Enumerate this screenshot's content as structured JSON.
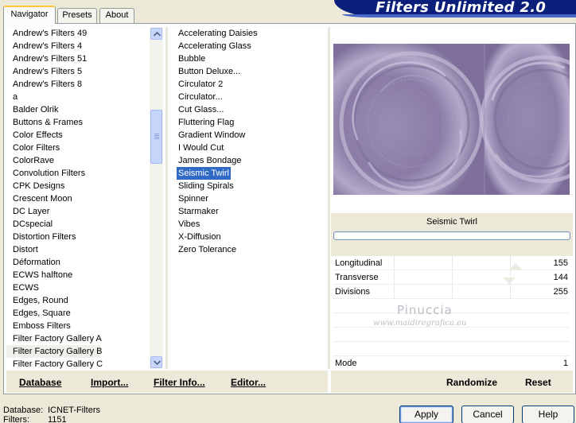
{
  "header": {
    "title": "Filters Unlimited 2.0"
  },
  "tabs": [
    {
      "label": "Navigator",
      "active": true
    },
    {
      "label": "Presets",
      "active": false
    },
    {
      "label": "About",
      "active": false
    }
  ],
  "categories": [
    "Andrew's Filters 49",
    "Andrew's Filters 4",
    "Andrew's Filters 51",
    "Andrew's Filters 5",
    "Andrew's Filters 8",
    "a",
    "Balder Olrik",
    "Buttons & Frames",
    "Color Effects",
    "Color Filters",
    "ColorRave",
    "Convolution Filters",
    "CPK Designs",
    "Crescent Moon",
    "DC Layer",
    "DCspecial",
    "Distortion Filters",
    "Distort",
    "Déformation",
    "ECWS halftone",
    "ECWS",
    "Edges, Round",
    "Edges, Square",
    "Emboss Filters",
    "Filter Factory Gallery A",
    "Filter Factory Gallery B",
    "Filter Factory Gallery C"
  ],
  "current_category": "Filter Factory Gallery B",
  "filters": [
    "Accelerating Daisies",
    "Accelerating Glass",
    "Bubble",
    "Button Deluxe...",
    "Circulator 2",
    "Circulator...",
    "Cut Glass...",
    "Fluttering Flag",
    "Gradient Window",
    "I Would Cut",
    "James Bondage",
    "Seismic Twirl",
    "Sliding Spirals",
    "Spinner",
    "Starmaker",
    "Vibes",
    "X-Diffusion",
    "Zero Tolerance"
  ],
  "selected_filter": "Seismic Twirl",
  "preview": {
    "filter_name": "Seismic Twirl",
    "tint": "#8e80a9"
  },
  "params": [
    {
      "label": "Longitudinal",
      "value": "155",
      "level": 155
    },
    {
      "label": "Transverse",
      "value": "144",
      "level": 144
    },
    {
      "label": "Divisions",
      "value": "255",
      "level": 255
    }
  ],
  "mode": {
    "label": "Mode",
    "value": "1"
  },
  "watermark": {
    "line1": "Pinuccia",
    "line2": "www.maidiregrafica.eu"
  },
  "left_buttons": {
    "database": "Database",
    "import": "Import...",
    "filter_info": "Filter Info...",
    "editor": "Editor..."
  },
  "right_buttons": {
    "randomize": "Randomize",
    "reset": "Reset"
  },
  "status": {
    "database_label": "Database:",
    "database_value": "ICNET-Filters",
    "filters_label": "Filters:",
    "filters_value": "1151"
  },
  "dialog_buttons": {
    "apply": "Apply",
    "cancel": "Cancel",
    "help": "Help"
  }
}
